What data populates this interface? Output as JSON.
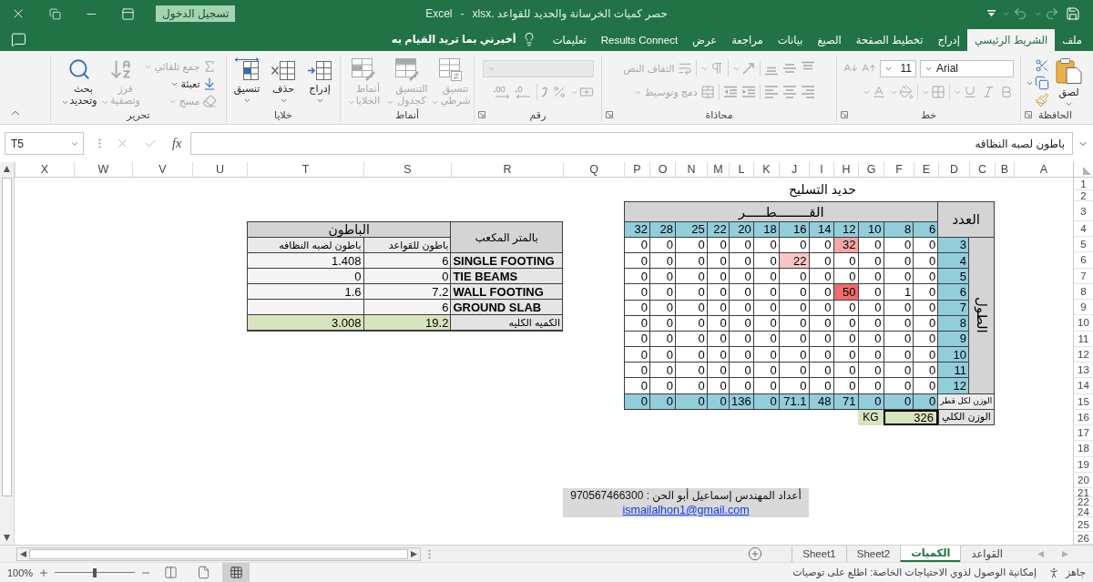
{
  "window": {
    "file_name": "حصر كميات الخرسانة والحديد للقواعد .xlsx",
    "separator": "-",
    "app_name": "Excel",
    "sign_in": "تسجيل الدخول"
  },
  "quick_access": [
    {
      "kind": "save",
      "disabled": false
    },
    {
      "kind": "undo",
      "disabled": true
    },
    {
      "kind": "redo",
      "disabled": true
    }
  ],
  "ribbon_tabs": [
    {
      "label": "ملف",
      "selected": false
    },
    {
      "label": "الشريط الرئيسي",
      "selected": true
    },
    {
      "label": "إدراج",
      "selected": false
    },
    {
      "label": "تخطيط الصفحة",
      "selected": false
    },
    {
      "label": "الصيغ",
      "selected": false
    },
    {
      "label": "بيانات",
      "selected": false
    },
    {
      "label": "مراجعة",
      "selected": false
    },
    {
      "label": "عرض",
      "selected": false
    },
    {
      "label": "Results Connect",
      "selected": false
    },
    {
      "label": "تعليمات",
      "selected": false
    }
  ],
  "tell_me": {
    "placeholder": "أخبرني بما تريد القيام به"
  },
  "ribbon": {
    "groups": [
      {
        "kind": "clipboard",
        "label": "الحافظة",
        "paste": {
          "label": "لصق",
          "disabled": false
        }
      },
      {
        "kind": "font",
        "label": "خط",
        "font_name": "Arial",
        "font_size": "11",
        "disabled": true
      },
      {
        "kind": "alignment",
        "label": "محاذاة",
        "disabled": true,
        "wrap_text": {
          "label": "التفاف النص",
          "disabled": true
        },
        "merge": {
          "label": "دمج وتوسيط",
          "disabled": true
        }
      },
      {
        "kind": "number",
        "label": "رقم",
        "disabled": true
      },
      {
        "kind": "styles",
        "label": "أنماط",
        "buttons": [
          {
            "kind": "conditional",
            "label": "تنسيق\nشرطي",
            "disabled": true
          },
          {
            "kind": "table",
            "label": "التنسيق\nكجدول",
            "disabled": true
          },
          {
            "kind": "cell_styles",
            "label": "أنماط\nالخلايا",
            "disabled": true
          }
        ]
      },
      {
        "kind": "cells",
        "label": "خلايا",
        "buttons": [
          {
            "kind": "insert",
            "label": "إدراج",
            "disabled": false
          },
          {
            "kind": "delete",
            "label": "حذف",
            "disabled": false
          },
          {
            "kind": "format",
            "label": "تنسيق",
            "disabled": false
          }
        ]
      },
      {
        "kind": "editing",
        "label": "تحرير",
        "buttons": [
          {
            "kind": "autosum",
            "label": "جمع تلقائي",
            "disabled": true
          },
          {
            "kind": "fill",
            "label": "تعبئة",
            "disabled": false
          },
          {
            "kind": "clear",
            "label": "مسح",
            "disabled": true
          },
          {
            "kind": "sort",
            "label": "فرز\nوتصفية",
            "disabled": true
          },
          {
            "kind": "find",
            "label": "بحث\nوتحديد",
            "disabled": false
          }
        ]
      }
    ]
  },
  "formula_bar": {
    "name_box": "T5",
    "insert_function": "fx",
    "editing": false,
    "formula": "باطون لصبه النظافه"
  },
  "sheet": {
    "columns": [
      "A",
      "B",
      "C",
      "D",
      "E",
      "F",
      "G",
      "H",
      "I",
      "J",
      "K",
      "L",
      "M",
      "N",
      "O",
      "P",
      "Q",
      "R",
      "S",
      "T",
      "U",
      "V",
      "W",
      "X"
    ],
    "rows": [
      "1",
      "2",
      "3",
      "4",
      "5",
      "6",
      "7",
      "8",
      "9",
      "10",
      "11",
      "12",
      "13",
      "14",
      "15",
      "16",
      "17",
      "18",
      "19",
      "20",
      "21",
      "22",
      "24",
      "25",
      "26"
    ],
    "rebar": {
      "title": "حديد التسليح",
      "count_header": "العدد",
      "diameter_header": "القــــــــطـــــر",
      "length_header": "الطول",
      "diameters": [
        "6",
        "8",
        "10",
        "12",
        "14",
        "16",
        "18",
        "20",
        "22",
        "25",
        "28",
        "32"
      ],
      "rows": [
        {
          "count": "3",
          "cells": [
            {
              "value": "0"
            },
            {
              "value": "0"
            },
            {
              "value": "0"
            },
            {
              "value": "32",
              "color": "#f4a7a7"
            },
            {
              "value": "0"
            },
            {
              "value": "0"
            },
            {
              "value": "0"
            },
            {
              "value": "0"
            },
            {
              "value": "0"
            },
            {
              "value": "0"
            },
            {
              "value": "0"
            },
            {
              "value": "0"
            }
          ]
        },
        {
          "count": "4",
          "cells": [
            {
              "value": "0"
            },
            {
              "value": "0"
            },
            {
              "value": "0"
            },
            {
              "value": "0"
            },
            {
              "value": "0"
            },
            {
              "value": "22",
              "color": "#f9c6c6"
            },
            {
              "value": "0"
            },
            {
              "value": "0"
            },
            {
              "value": "0"
            },
            {
              "value": "0"
            },
            {
              "value": "0"
            },
            {
              "value": "0"
            }
          ]
        },
        {
          "count": "5",
          "cells": [
            {
              "value": "0"
            },
            {
              "value": "0"
            },
            {
              "value": "0"
            },
            {
              "value": "0"
            },
            {
              "value": "0"
            },
            {
              "value": "0"
            },
            {
              "value": "0"
            },
            {
              "value": "0"
            },
            {
              "value": "0"
            },
            {
              "value": "0"
            },
            {
              "value": "0"
            },
            {
              "value": "0"
            }
          ]
        },
        {
          "count": "6",
          "cells": [
            {
              "value": "0"
            },
            {
              "value": "1"
            },
            {
              "value": "0"
            },
            {
              "value": "50",
              "color": "#f06b6b"
            },
            {
              "value": "0"
            },
            {
              "value": "0"
            },
            {
              "value": "0"
            },
            {
              "value": "0"
            },
            {
              "value": "0"
            },
            {
              "value": "0"
            },
            {
              "value": "0"
            },
            {
              "value": "0"
            }
          ]
        },
        {
          "count": "7",
          "cells": [
            {
              "value": "0"
            },
            {
              "value": "0"
            },
            {
              "value": "0"
            },
            {
              "value": "0"
            },
            {
              "value": "0"
            },
            {
              "value": "0"
            },
            {
              "value": "0"
            },
            {
              "value": "0"
            },
            {
              "value": "0"
            },
            {
              "value": "0"
            },
            {
              "value": "0"
            },
            {
              "value": "0"
            }
          ]
        },
        {
          "count": "8",
          "cells": [
            {
              "value": "0"
            },
            {
              "value": "0"
            },
            {
              "value": "0"
            },
            {
              "value": "0"
            },
            {
              "value": "0"
            },
            {
              "value": "0"
            },
            {
              "value": "0"
            },
            {
              "value": "0"
            },
            {
              "value": "0"
            },
            {
              "value": "0"
            },
            {
              "value": "0"
            },
            {
              "value": "0"
            }
          ]
        },
        {
          "count": "9",
          "cells": [
            {
              "value": "0"
            },
            {
              "value": "0"
            },
            {
              "value": "0"
            },
            {
              "value": "0"
            },
            {
              "value": "0"
            },
            {
              "value": "0"
            },
            {
              "value": "0"
            },
            {
              "value": "0"
            },
            {
              "value": "0"
            },
            {
              "value": "0"
            },
            {
              "value": "0"
            },
            {
              "value": "0"
            }
          ]
        },
        {
          "count": "10",
          "cells": [
            {
              "value": "0"
            },
            {
              "value": "0"
            },
            {
              "value": "0"
            },
            {
              "value": "0"
            },
            {
              "value": "0"
            },
            {
              "value": "0"
            },
            {
              "value": "0"
            },
            {
              "value": "0"
            },
            {
              "value": "0"
            },
            {
              "value": "0"
            },
            {
              "value": "0"
            },
            {
              "value": "0"
            }
          ]
        },
        {
          "count": "11",
          "cells": [
            {
              "value": "0"
            },
            {
              "value": "0"
            },
            {
              "value": "0"
            },
            {
              "value": "0"
            },
            {
              "value": "0"
            },
            {
              "value": "0"
            },
            {
              "value": "0"
            },
            {
              "value": "0"
            },
            {
              "value": "0"
            },
            {
              "value": "0"
            },
            {
              "value": "0"
            },
            {
              "value": "0"
            }
          ]
        },
        {
          "count": "12",
          "cells": [
            {
              "value": "0"
            },
            {
              "value": "0"
            },
            {
              "value": "0"
            },
            {
              "value": "0"
            },
            {
              "value": "0"
            },
            {
              "value": "0"
            },
            {
              "value": "0"
            },
            {
              "value": "0"
            },
            {
              "value": "0"
            },
            {
              "value": "0"
            },
            {
              "value": "0"
            },
            {
              "value": "0"
            }
          ]
        }
      ],
      "totals_label": "الوزن لكل قطر",
      "totals": [
        "0",
        "0",
        "0",
        "71",
        "48",
        "71.1",
        "0",
        "136",
        "0",
        "0",
        "0",
        "0"
      ],
      "grand_total_label": "الوزن الكلي",
      "grand_total": "326",
      "unit": "KG"
    },
    "concrete": {
      "unit_header": "بالمتر المكعب",
      "group_header": "الباطون",
      "columns": [
        "باطون للقواعد",
        "باطون لصبه النظافه"
      ],
      "rows": [
        {
          "label": "SINGLE FOOTING",
          "values": [
            "6",
            "1.408"
          ]
        },
        {
          "label": "TIE BEAMS",
          "values": [
            "0",
            "0"
          ]
        },
        {
          "label": "WALL FOOTING",
          "values": [
            "7.2",
            "1.6"
          ]
        },
        {
          "label": "GROUND SLAB",
          "values": [
            "6"
          ]
        }
      ],
      "total": {
        "label": "الكميه الكليه",
        "values": [
          "19.2",
          "3.008"
        ]
      }
    },
    "credit": {
      "text": "أعداد المهندس إسماعيل أبو الحن : 970567466300",
      "email": "ismailalhon1@gmail.com"
    }
  },
  "sheet_tabs": [
    {
      "label": "القواعد",
      "selected": false
    },
    {
      "label": "الكميات",
      "selected": true
    },
    {
      "label": "Sheet2",
      "selected": false
    },
    {
      "label": "Sheet1",
      "selected": false
    }
  ],
  "status_bar": {
    "ready": "جاهز",
    "accessibility": "إمكانية الوصول لذوي الاحتياجات الخاصة: اطلع على توصيات",
    "views": [
      {
        "kind": "normal",
        "selected": true
      },
      {
        "kind": "page_layout",
        "selected": false
      },
      {
        "kind": "page_break",
        "selected": false
      }
    ],
    "zoom": {
      "level": 0.5
    },
    "zoom_text": "100%"
  }
}
